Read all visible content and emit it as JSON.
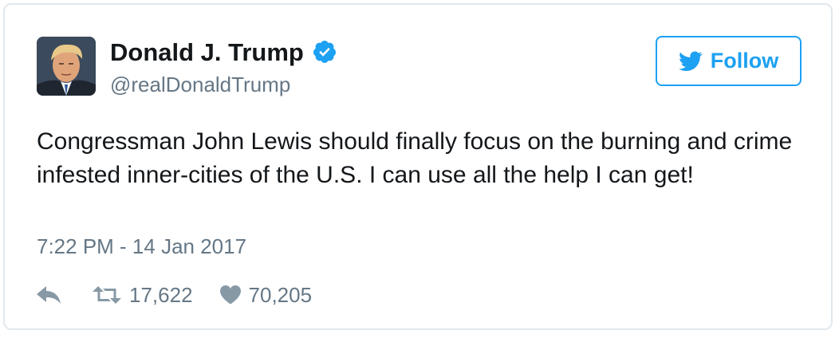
{
  "user": {
    "display_name": "Donald J. Trump",
    "handle": "@realDonaldTrump",
    "verified": true,
    "avatar": "profile-photo"
  },
  "follow_button": {
    "label": "Follow",
    "icon": "twitter-bird-icon"
  },
  "tweet": {
    "text": "Congressman John Lewis should finally focus on the burning and crime infested inner-cities of the U.S. I can use all the help I can get!",
    "timestamp": "7:22 PM - 14 Jan 2017"
  },
  "actions": {
    "reply_icon": "reply-icon",
    "retweet_icon": "retweet-icon",
    "retweet_count": "17,622",
    "like_icon": "heart-icon",
    "like_count": "70,205"
  },
  "colors": {
    "accent": "#1da1f2",
    "text": "#14171a",
    "secondary": "#657786",
    "border": "#e1e8ed"
  }
}
